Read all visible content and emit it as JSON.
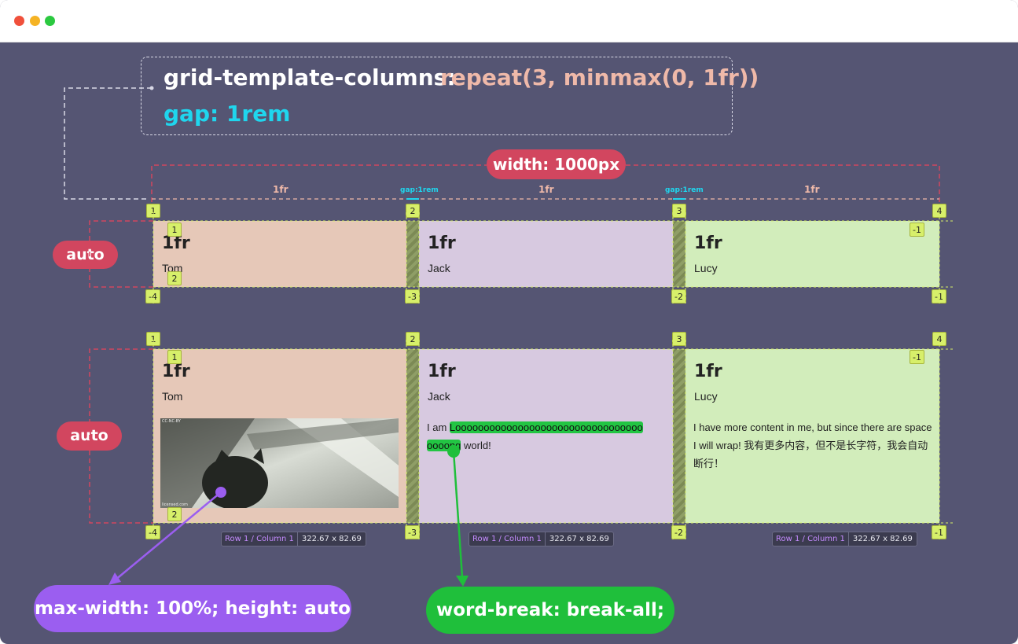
{
  "window": {
    "traffic_lights": {
      "red": "#f0503b",
      "yellow": "#f5b324",
      "green": "#2bc940"
    }
  },
  "code": {
    "property": "grid-template-columns:",
    "value": "repeat(3,  minmax(0, 1fr))",
    "gap": "gap: 1rem"
  },
  "width_label": "width: 1000px",
  "column_labels": [
    "1fr",
    "1fr",
    "1fr"
  ],
  "gap_labels": [
    "gap:1rem",
    "gap:1rem"
  ],
  "row_labels": [
    "auto",
    "auto"
  ],
  "grid1": {
    "cells": [
      {
        "fr": "1fr",
        "name": "Tom"
      },
      {
        "fr": "1fr",
        "name": "Jack"
      },
      {
        "fr": "1fr",
        "name": "Lucy"
      }
    ],
    "col_top": [
      "1",
      "2",
      "3",
      "4"
    ],
    "col_bottom": [
      "-4",
      "-3",
      "-2",
      "-1"
    ],
    "row_inner": [
      "1",
      "2",
      "-1"
    ]
  },
  "grid2": {
    "cells": [
      {
        "fr": "1fr",
        "name": "Tom"
      },
      {
        "fr": "1fr",
        "name": "Jack",
        "text_before": "I am ",
        "long_word_1": "Looooooooooooooooooooooooooooooooo",
        "long_word_2": "oooong",
        "text_after": " world!"
      },
      {
        "fr": "1fr",
        "name": "Lucy",
        "text": "I have more content in me, but since there are space I will wrap! 我有更多内容，但不是长字符，我会自动断行！"
      }
    ],
    "col_top": [
      "1",
      "2",
      "3",
      "4"
    ],
    "col_bottom": [
      "-4",
      "-3",
      "-2",
      "-1"
    ],
    "row_inner": [
      "1",
      "2",
      "-1"
    ],
    "size_tags": [
      {
        "rc": "Row 1 / Column 1",
        "dim": "322.67 x 82.69"
      },
      {
        "rc": "Row 1 / Column 1",
        "dim": "322.67 x 82.69"
      },
      {
        "rc": "Row 1 / Column 1",
        "dim": "322.67 x 82.69"
      }
    ]
  },
  "image_tiny_text": {
    "top": "CC-NC-BY",
    "bottom": "licensed.com"
  },
  "callouts": {
    "image_rule": "max-width: 100%; height: auto",
    "word_rule": "word-break: break-all;"
  },
  "colors": {
    "background": "#555573",
    "cell_1": "#e6c8b8",
    "cell_2": "#d7c9e0",
    "cell_3": "#d2edbb",
    "accent_red": "#d2465f",
    "accent_purple": "#9b5ef0",
    "accent_green": "#1fbf3b",
    "code_cyan": "#1fd6ee",
    "code_peach": "#efb9a9",
    "badge": "#d7ef6a"
  }
}
